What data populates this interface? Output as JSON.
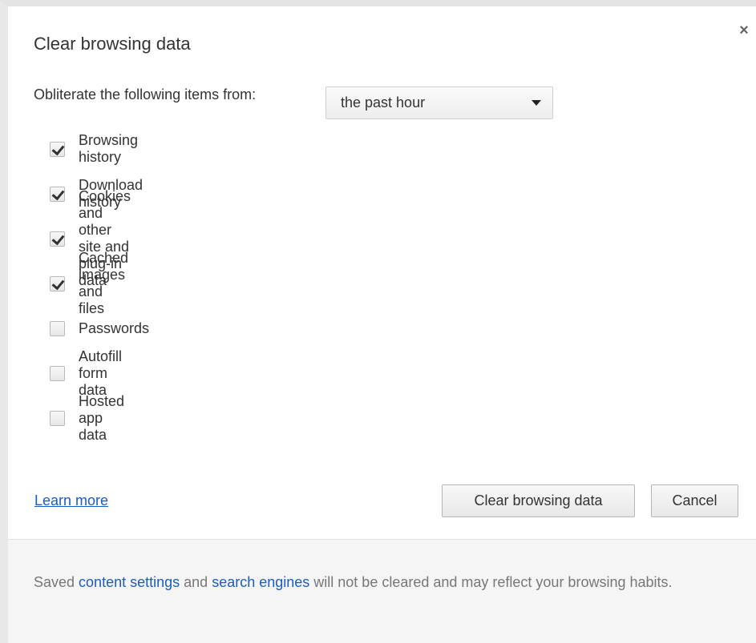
{
  "dialog": {
    "title": "Clear browsing data",
    "close_label": "×"
  },
  "period": {
    "label": "Obliterate the following items from:",
    "selected": "the past hour"
  },
  "options": [
    {
      "label": "Browsing history",
      "checked": true
    },
    {
      "label": "Download history",
      "checked": true
    },
    {
      "label": "Cookies and other site and plug-in data",
      "checked": true
    },
    {
      "label": "Cached images and files",
      "checked": true
    },
    {
      "label": "Passwords",
      "checked": false
    },
    {
      "label": "Autofill form data",
      "checked": false
    },
    {
      "label": "Hosted app data",
      "checked": false
    }
  ],
  "actions": {
    "learn_more": "Learn more",
    "clear_button": "Clear browsing data",
    "cancel_button": "Cancel"
  },
  "footer": {
    "prefix": "Saved ",
    "link1": "content settings",
    "middle": " and ",
    "link2": "search engines",
    "suffix": " will not be cleared and may reflect your browsing habits."
  },
  "colors": {
    "link": "#1a5cbf",
    "footer_bg": "#f5f5f5"
  }
}
